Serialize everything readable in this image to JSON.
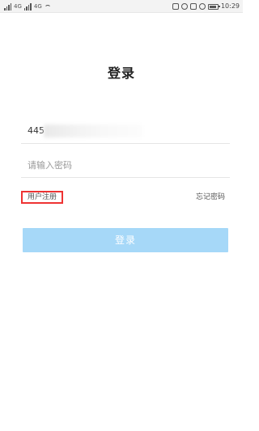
{
  "status_bar": {
    "carrier_text": "4G",
    "data_text": "4G",
    "battery_level": 0.7,
    "time": "10:29"
  },
  "page": {
    "title": "登录"
  },
  "account": {
    "value": "445"
  },
  "password": {
    "placeholder": "请输入密码"
  },
  "links": {
    "register": "用户注册",
    "forgot": "忘记密码"
  },
  "login_button": {
    "label": "登录",
    "color": "#a6d8f8"
  },
  "colors": {
    "highlight_border": "#e33333"
  }
}
